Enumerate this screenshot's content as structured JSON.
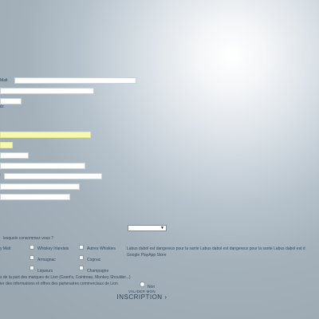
{
  "form": {
    "malt_label": "Malt",
    "partial_label_1": "ilz",
    "question_spirits": "lesquels consommez-vous ?",
    "spirits": [
      {
        "label": "y Malt",
        "checked": false
      },
      {
        "label": "Whiskey Irlandais",
        "checked": false
      },
      {
        "label": "Autres Whiskies",
        "checked": false
      },
      {
        "label": "Armagnac",
        "checked": false
      },
      {
        "label": "Cognac",
        "checked": false
      },
      {
        "label": "Liqueurs",
        "checked": false
      },
      {
        "label": "Champagne",
        "checked": false
      }
    ],
    "optin_brands": "s de la part des marques de Lion (Grant's, Cointreau, Monkey Shoulder...)",
    "optin_partners": "ier des informations et offres des partenaires commerciaux de Lion",
    "non_label": "Non",
    "submit_small": "VALIDER MON",
    "submit_big": "INSCRIPTION",
    "submit_arrow": "›"
  },
  "disclaimer": {
    "line1": "Labus dabol est dangereux pour la sante Labus dabol est dangereux pour la sante Labus dabol est d",
    "line2": "Google PlayApp Store"
  },
  "select": {
    "arrow": "▼",
    "value": ""
  }
}
